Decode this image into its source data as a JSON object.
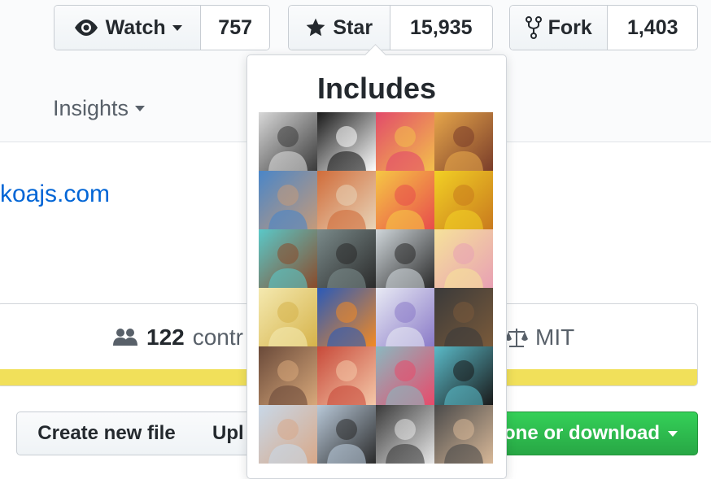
{
  "header": {
    "watch": {
      "label": "Watch",
      "count": "757"
    },
    "star": {
      "label": "Star",
      "count": "15,935"
    },
    "fork": {
      "label": "Fork",
      "count": "1,403"
    }
  },
  "nav": {
    "insights_label": "Insights"
  },
  "repo": {
    "homepage_text": "koajs.com"
  },
  "summary": {
    "contributors_count": "122",
    "contributors_label": "contr",
    "license": "MIT"
  },
  "actions": {
    "create_file": "Create new file",
    "upload": "Upl",
    "clone": "one or download"
  },
  "popover": {
    "title": "Includes",
    "avatars": [
      {
        "name": "avatar-1",
        "c1": "#d8d8d8",
        "c2": "#3a3a3a"
      },
      {
        "name": "avatar-2",
        "c1": "#1a1a1a",
        "c2": "#ffffff"
      },
      {
        "name": "avatar-3",
        "c1": "#e24a6a",
        "c2": "#f3c04c"
      },
      {
        "name": "avatar-4",
        "c1": "#e6a64a",
        "c2": "#7a3d2a"
      },
      {
        "name": "avatar-5",
        "c1": "#4a86c8",
        "c2": "#c49a7a"
      },
      {
        "name": "avatar-6",
        "c1": "#d06c3a",
        "c2": "#e8d4b8"
      },
      {
        "name": "avatar-7",
        "c1": "#f6c744",
        "c2": "#e84c4c"
      },
      {
        "name": "avatar-8",
        "c1": "#f2d024",
        "c2": "#c97a1e"
      },
      {
        "name": "avatar-9",
        "c1": "#5ac8c8",
        "c2": "#8a4a2a"
      },
      {
        "name": "avatar-10",
        "c1": "#7a8a8a",
        "c2": "#2a2a2a"
      },
      {
        "name": "avatar-11",
        "c1": "#cfd6da",
        "c2": "#2a2a2a"
      },
      {
        "name": "avatar-12",
        "c1": "#f6e29a",
        "c2": "#e8a0b4"
      },
      {
        "name": "avatar-13",
        "c1": "#f4e9b0",
        "c2": "#d6b34a"
      },
      {
        "name": "avatar-14",
        "c1": "#2a5ab8",
        "c2": "#f28a24"
      },
      {
        "name": "avatar-15",
        "c1": "#e8eaf4",
        "c2": "#8a7ac8"
      },
      {
        "name": "avatar-16",
        "c1": "#3a3a3a",
        "c2": "#7a5a3a"
      },
      {
        "name": "avatar-17",
        "c1": "#6a4a3a",
        "c2": "#d8a87a"
      },
      {
        "name": "avatar-18",
        "c1": "#c84a3a",
        "c2": "#f4c8a8"
      },
      {
        "name": "avatar-19",
        "c1": "#8ab8c0",
        "c2": "#e84a6a"
      },
      {
        "name": "avatar-20",
        "c1": "#5abac8",
        "c2": "#1a1a1a"
      },
      {
        "name": "avatar-21",
        "c1": "#c8d8e8",
        "c2": "#d8a888"
      },
      {
        "name": "avatar-22",
        "c1": "#b8c8d8",
        "c2": "#2a2a2a"
      },
      {
        "name": "avatar-23",
        "c1": "#3a3a3a",
        "c2": "#e8e8e8"
      },
      {
        "name": "avatar-24",
        "c1": "#4a4a4a",
        "c2": "#d8b898"
      }
    ]
  },
  "colors": {
    "link": "#0366d6",
    "language_bar": "#f1e05a",
    "primary_button": "#28a745"
  }
}
